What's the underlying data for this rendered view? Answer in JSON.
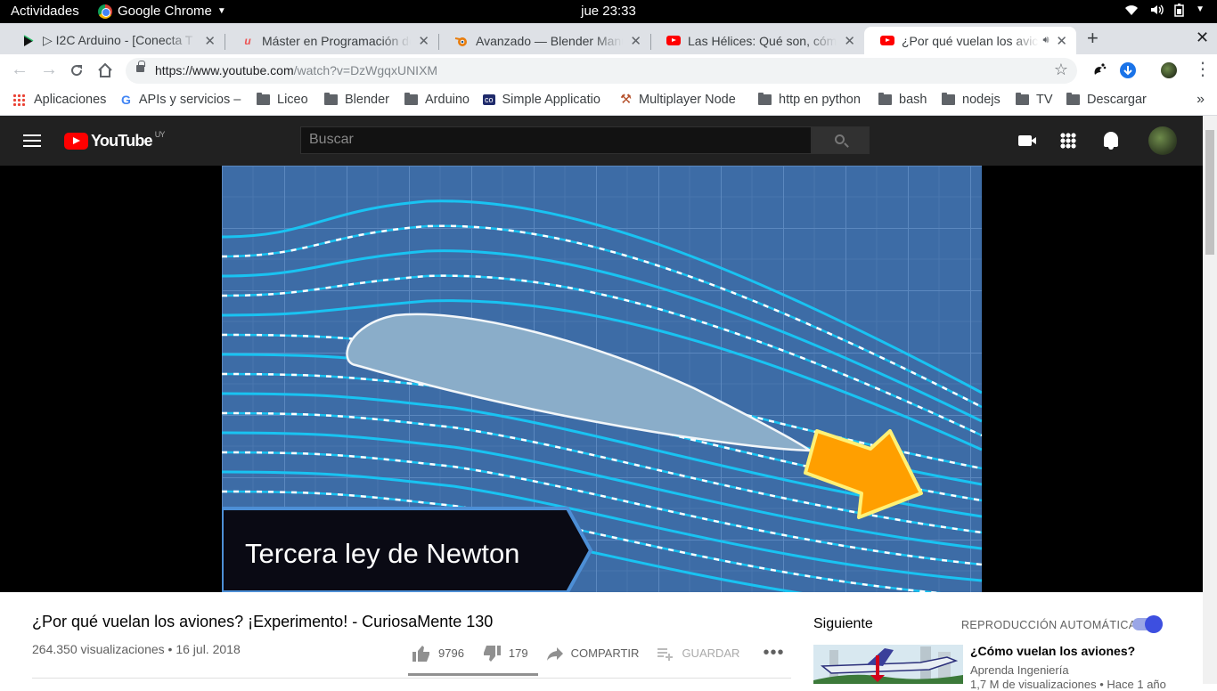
{
  "gnome": {
    "activities": "Actividades",
    "app_name": "Google Chrome",
    "clock": "jue 23:33"
  },
  "tabs": [
    {
      "title": "▷ I2C Arduino - [Conecta T",
      "icon": "arduino-play-icon"
    },
    {
      "title": "Máster en Programación de",
      "icon": "udemy-icon"
    },
    {
      "title": "Avanzado — Blender Manu",
      "icon": "blender-icon"
    },
    {
      "title": "Las Hélices: Qué son, cóm",
      "icon": "youtube-icon"
    },
    {
      "title": "¿Por qué vuelan los avic",
      "icon": "youtube-icon",
      "active": true
    }
  ],
  "address": {
    "url_host": "https://www.youtube.com",
    "url_rest": "/watch?v=DzWgqxUNIXM"
  },
  "bookmarks": [
    {
      "label": "Aplicaciones",
      "icon": "apps-grid-icon"
    },
    {
      "label": "APIs y servicios –",
      "icon": "google-icon"
    },
    {
      "label": "Liceo",
      "icon": "folder-icon"
    },
    {
      "label": "Blender",
      "icon": "folder-icon"
    },
    {
      "label": "Arduino",
      "icon": "folder-icon"
    },
    {
      "label": "Simple Applicatio",
      "icon": "co-icon"
    },
    {
      "label": "Multiplayer Node",
      "icon": "axe-icon"
    },
    {
      "label": "http en python",
      "icon": "folder-icon"
    },
    {
      "label": "bash",
      "icon": "folder-icon"
    },
    {
      "label": "nodejs",
      "icon": "folder-icon"
    },
    {
      "label": "TV",
      "icon": "folder-icon"
    },
    {
      "label": "Descargar",
      "icon": "folder-icon"
    }
  ],
  "youtube": {
    "logo_text": "YouTube",
    "region": "UY",
    "search_placeholder": "Buscar"
  },
  "video": {
    "overlay_caption": "Tercera ley de Newton",
    "title": "¿Por qué vuelan los aviones? ¡Experimento! - CuriosaMente 130",
    "meta": "264.350 visualizaciones • 16 jul. 2018",
    "likes": "9796",
    "dislikes": "179",
    "share_label": "COMPARTIR",
    "save_label": "GUARDAR",
    "like_ratio": 0.982
  },
  "sidebar": {
    "next_label": "Siguiente",
    "autoplay_label": "REPRODUCCIÓN AUTOMÁTICA",
    "autoplay_on": true,
    "recommended": {
      "title": "¿Cómo vuelan los aviones?",
      "channel": "Aprenda Ingeniería",
      "views": "1,7 M de visualizaciones • Hace 1 año"
    }
  },
  "colors": {
    "yt_header": "#212121",
    "yt_red": "#ff0000",
    "video_blue": "#3f6fa8",
    "streamline": "#19c3f2",
    "arrow_orange": "#ff9f00"
  }
}
